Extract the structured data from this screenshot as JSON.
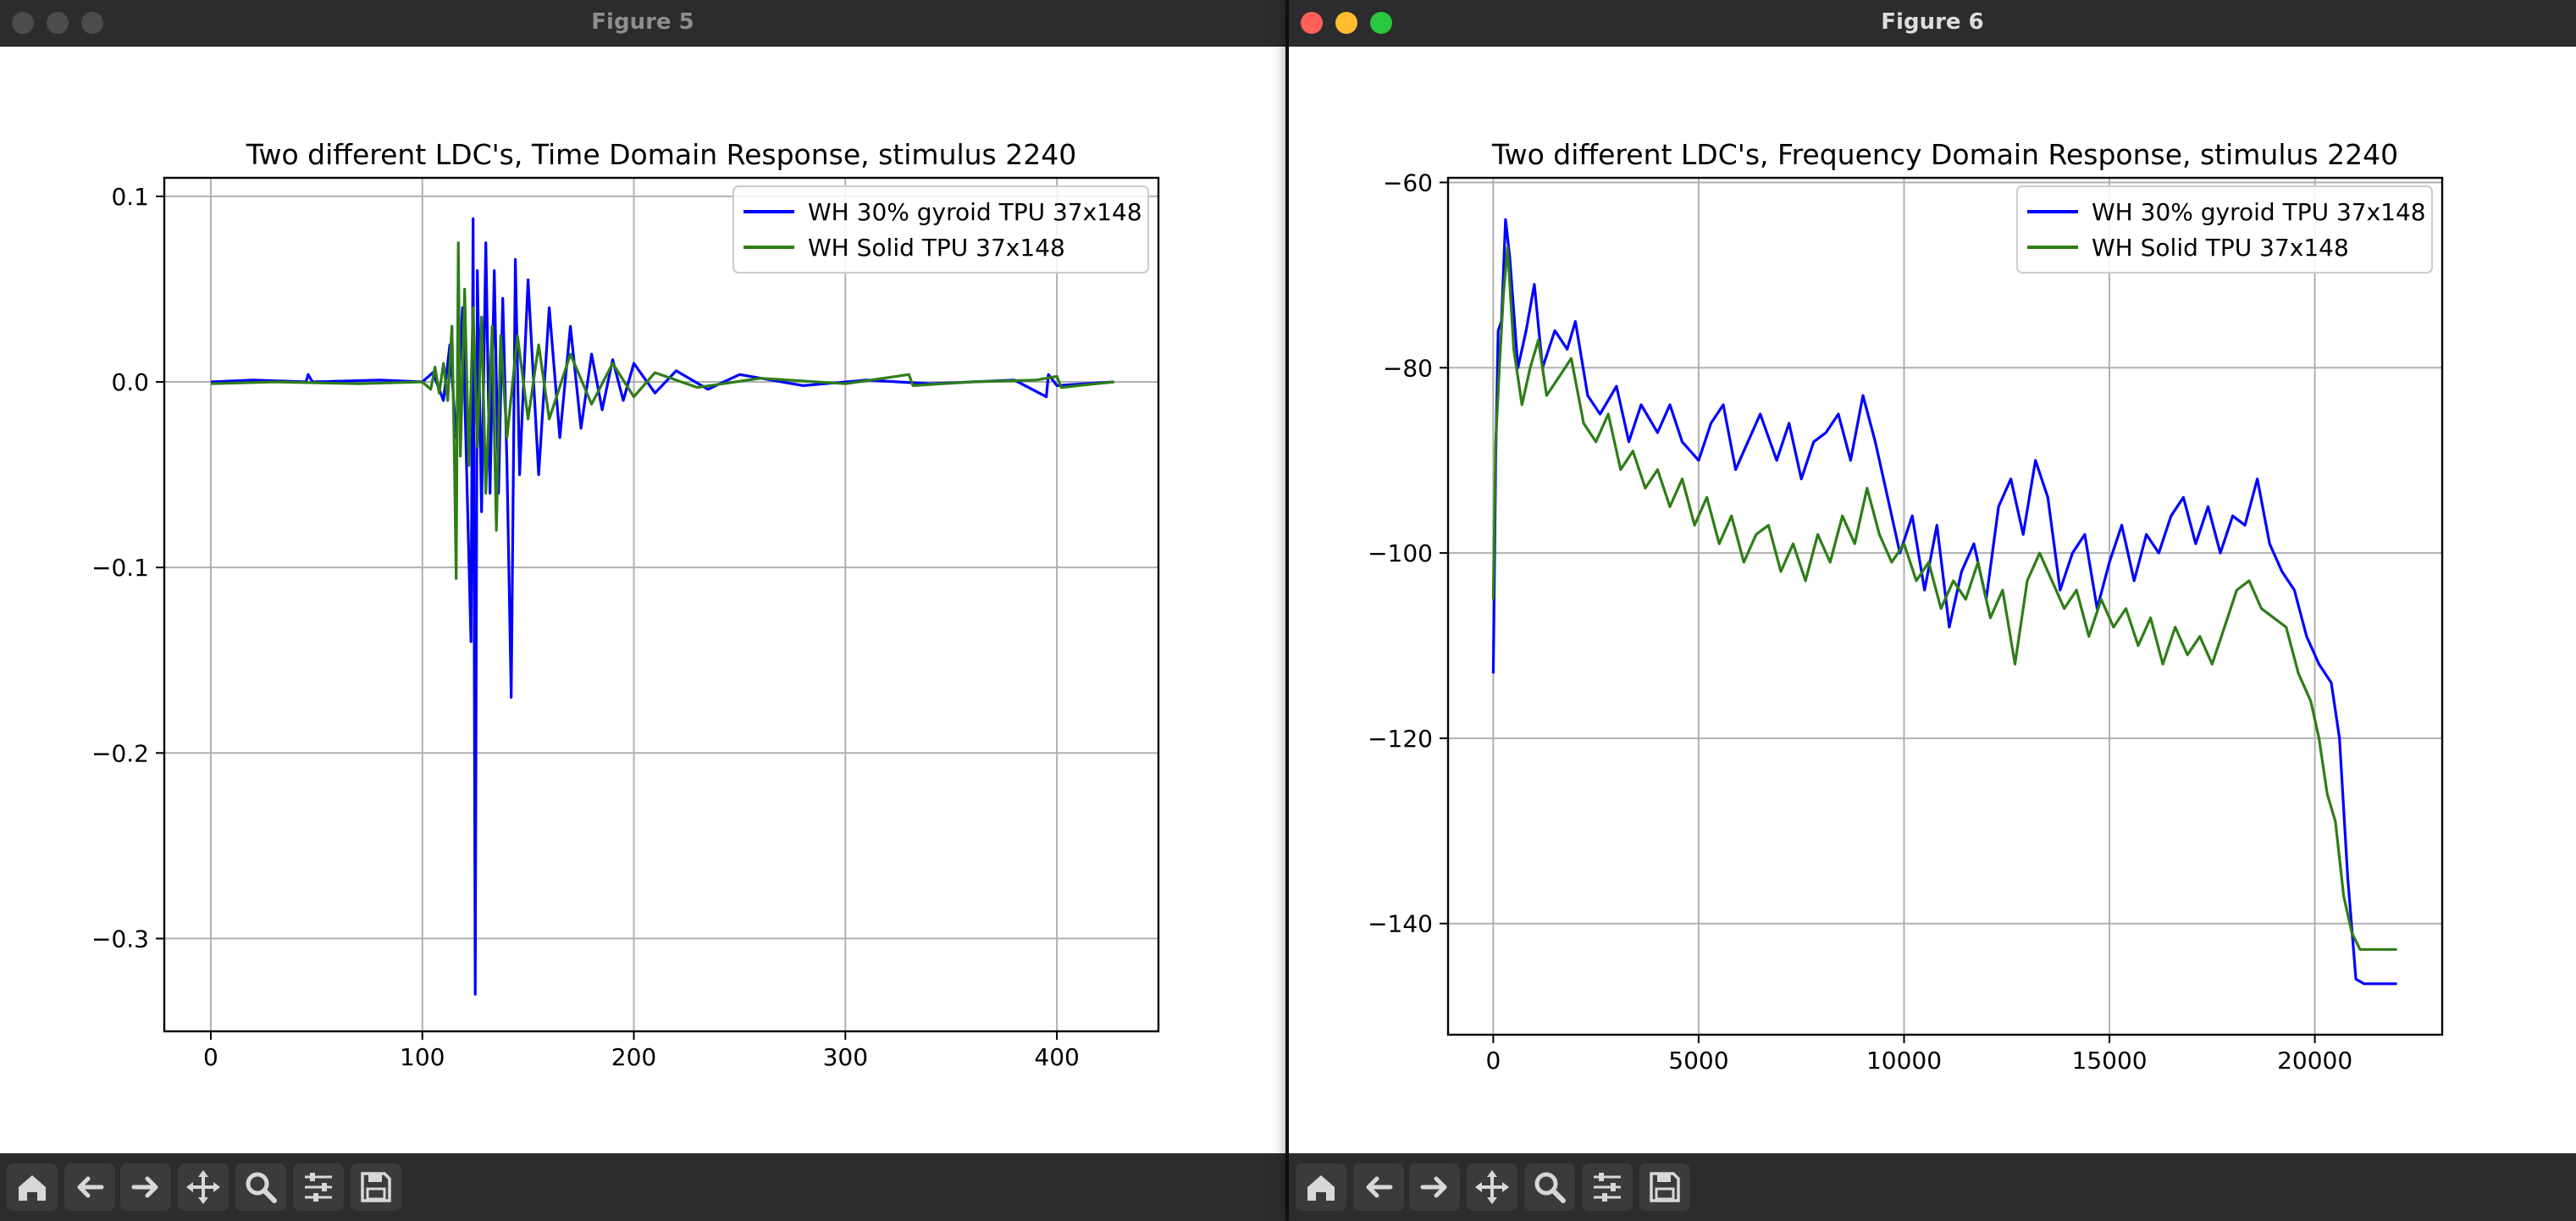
{
  "windows": [
    {
      "title": "Figure 5"
    },
    {
      "title": "Figure 6"
    }
  ],
  "toolbar": {
    "buttons": [
      {
        "icon": "home-icon"
      },
      {
        "icon": "back-arrow-icon"
      },
      {
        "icon": "forward-arrow-icon"
      },
      {
        "icon": "pan-icon"
      },
      {
        "icon": "zoom-icon"
      },
      {
        "icon": "sliders-icon"
      },
      {
        "icon": "save-icon"
      }
    ]
  },
  "chart_data": [
    {
      "type": "line",
      "title": "Two different LDC's, Time Domain Response, stimulus 2240",
      "xlabel": "",
      "ylabel": "",
      "xlim": [
        -22,
        448
      ],
      "ylim": [
        -0.35,
        0.11
      ],
      "xticks": [
        0,
        100,
        200,
        300,
        400
      ],
      "xtick_labels": [
        "0",
        "100",
        "200",
        "300",
        "400"
      ],
      "yticks": [
        0.1,
        0.0,
        -0.1,
        -0.2,
        -0.3
      ],
      "ytick_labels": [
        "0.1",
        "0.0",
        "−0.1",
        "−0.2",
        "−0.3"
      ],
      "grid": true,
      "legend_position": "upper right",
      "series": [
        {
          "name": "WH 30% gyroid TPU 37x148",
          "color": "#0000ff",
          "points": [
            [
              0,
              0.0
            ],
            [
              20,
              0.001
            ],
            [
              45,
              0.0
            ],
            [
              46,
              0.004
            ],
            [
              48,
              0.0
            ],
            [
              80,
              0.001
            ],
            [
              100,
              0.0
            ],
            [
              105,
              0.005
            ],
            [
              110,
              -0.01
            ],
            [
              113,
              0.02
            ],
            [
              116,
              -0.03
            ],
            [
              119,
              0.04
            ],
            [
              121,
              -0.05
            ],
            [
              123,
              -0.14
            ],
            [
              124,
              0.088
            ],
            [
              125,
              -0.33
            ],
            [
              126,
              0.06
            ],
            [
              128,
              -0.07
            ],
            [
              130,
              0.075
            ],
            [
              132,
              -0.06
            ],
            [
              134,
              0.06
            ],
            [
              136,
              -0.06
            ],
            [
              138,
              0.045
            ],
            [
              140,
              -0.045
            ],
            [
              142,
              -0.17
            ],
            [
              144,
              0.066
            ],
            [
              146,
              -0.05
            ],
            [
              150,
              0.055
            ],
            [
              155,
              -0.05
            ],
            [
              160,
              0.04
            ],
            [
              165,
              -0.03
            ],
            [
              170,
              0.03
            ],
            [
              175,
              -0.025
            ],
            [
              180,
              0.015
            ],
            [
              185,
              -0.015
            ],
            [
              190,
              0.012
            ],
            [
              195,
              -0.01
            ],
            [
              200,
              0.01
            ],
            [
              210,
              -0.006
            ],
            [
              220,
              0.006
            ],
            [
              235,
              -0.004
            ],
            [
              250,
              0.004
            ],
            [
              280,
              -0.002
            ],
            [
              310,
              0.001
            ],
            [
              340,
              -0.001
            ],
            [
              380,
              0.001
            ],
            [
              395,
              -0.008
            ],
            [
              396,
              0.004
            ],
            [
              400,
              -0.002
            ],
            [
              427,
              0.0
            ]
          ]
        },
        {
          "name": "WH Solid TPU 37x148",
          "color": "#2e7d17",
          "points": [
            [
              0,
              -0.001
            ],
            [
              30,
              0.0
            ],
            [
              70,
              -0.001
            ],
            [
              100,
              0.0
            ],
            [
              104,
              -0.004
            ],
            [
              106,
              0.008
            ],
            [
              108,
              -0.006
            ],
            [
              110,
              0.01
            ],
            [
              112,
              -0.01
            ],
            [
              114,
              0.03
            ],
            [
              115,
              -0.03
            ],
            [
              116,
              -0.106
            ],
            [
              117,
              0.075
            ],
            [
              118,
              -0.04
            ],
            [
              120,
              0.05
            ],
            [
              122,
              -0.045
            ],
            [
              124,
              0.04
            ],
            [
              126,
              -0.035
            ],
            [
              128,
              0.035
            ],
            [
              130,
              -0.06
            ],
            [
              133,
              0.03
            ],
            [
              135,
              -0.08
            ],
            [
              137,
              0.025
            ],
            [
              140,
              -0.03
            ],
            [
              145,
              0.025
            ],
            [
              150,
              -0.02
            ],
            [
              155,
              0.02
            ],
            [
              160,
              -0.02
            ],
            [
              170,
              0.015
            ],
            [
              180,
              -0.012
            ],
            [
              190,
              0.01
            ],
            [
              200,
              -0.008
            ],
            [
              210,
              0.005
            ],
            [
              230,
              -0.003
            ],
            [
              260,
              0.002
            ],
            [
              300,
              -0.001
            ],
            [
              330,
              0.004
            ],
            [
              332,
              -0.002
            ],
            [
              360,
              0.0
            ],
            [
              390,
              0.001
            ],
            [
              400,
              0.003
            ],
            [
              402,
              -0.003
            ],
            [
              427,
              0.0
            ]
          ]
        }
      ]
    },
    {
      "type": "line",
      "title": "Two different LDC's, Frequency Domain Response, stimulus 2240",
      "xlabel": "",
      "ylabel": "",
      "xlim": [
        -1100,
        23100
      ],
      "ylim": [
        -152,
        -59.5
      ],
      "xticks": [
        0,
        5000,
        10000,
        15000,
        20000
      ],
      "xtick_labels": [
        "0",
        "5000",
        "10000",
        "15000",
        "20000"
      ],
      "yticks": [
        -60,
        -80,
        -100,
        -120,
        -140
      ],
      "ytick_labels": [
        "−60",
        "−80",
        "−100",
        "−120",
        "−140"
      ],
      "grid": true,
      "legend_position": "upper right",
      "series": [
        {
          "name": "WH 30% gyroid TPU 37x148",
          "color": "#0000ff",
          "points": [
            [
              0,
              -113
            ],
            [
              60,
              -90
            ],
            [
              120,
              -76
            ],
            [
              200,
              -75
            ],
            [
              300,
              -64
            ],
            [
              400,
              -68
            ],
            [
              600,
              -80
            ],
            [
              800,
              -76
            ],
            [
              1000,
              -71
            ],
            [
              1200,
              -80
            ],
            [
              1500,
              -76
            ],
            [
              1800,
              -78
            ],
            [
              2000,
              -75
            ],
            [
              2300,
              -83
            ],
            [
              2600,
              -85
            ],
            [
              3000,
              -82
            ],
            [
              3300,
              -88
            ],
            [
              3600,
              -84
            ],
            [
              4000,
              -87
            ],
            [
              4300,
              -84
            ],
            [
              4600,
              -88
            ],
            [
              5000,
              -90
            ],
            [
              5300,
              -86
            ],
            [
              5600,
              -84
            ],
            [
              5900,
              -91
            ],
            [
              6200,
              -88
            ],
            [
              6500,
              -85
            ],
            [
              6900,
              -90
            ],
            [
              7200,
              -86
            ],
            [
              7500,
              -92
            ],
            [
              7800,
              -88
            ],
            [
              8100,
              -87
            ],
            [
              8400,
              -85
            ],
            [
              8700,
              -90
            ],
            [
              9000,
              -83
            ],
            [
              9300,
              -88
            ],
            [
              9600,
              -94
            ],
            [
              9900,
              -100
            ],
            [
              10200,
              -96
            ],
            [
              10500,
              -104
            ],
            [
              10800,
              -97
            ],
            [
              11100,
              -108
            ],
            [
              11400,
              -102
            ],
            [
              11700,
              -99
            ],
            [
              12000,
              -105
            ],
            [
              12300,
              -95
            ],
            [
              12600,
              -92
            ],
            [
              12900,
              -98
            ],
            [
              13200,
              -90
            ],
            [
              13500,
              -94
            ],
            [
              13800,
              -104
            ],
            [
              14100,
              -100
            ],
            [
              14400,
              -98
            ],
            [
              14700,
              -106
            ],
            [
              15000,
              -101
            ],
            [
              15300,
              -97
            ],
            [
              15600,
              -103
            ],
            [
              15900,
              -98
            ],
            [
              16200,
              -100
            ],
            [
              16500,
              -96
            ],
            [
              16800,
              -94
            ],
            [
              17100,
              -99
            ],
            [
              17400,
              -95
            ],
            [
              17700,
              -100
            ],
            [
              18000,
              -96
            ],
            [
              18300,
              -97
            ],
            [
              18600,
              -92
            ],
            [
              18900,
              -99
            ],
            [
              19200,
              -102
            ],
            [
              19500,
              -104
            ],
            [
              19800,
              -109
            ],
            [
              20100,
              -112
            ],
            [
              20400,
              -114
            ],
            [
              20600,
              -120
            ],
            [
              20800,
              -135
            ],
            [
              21000,
              -146
            ],
            [
              21200,
              -146.5
            ],
            [
              22000,
              -146.5
            ]
          ]
        },
        {
          "name": "WH Solid TPU 37x148",
          "color": "#2e7d17",
          "points": [
            [
              0,
              -105
            ],
            [
              60,
              -88
            ],
            [
              150,
              -80
            ],
            [
              250,
              -72
            ],
            [
              350,
              -67
            ],
            [
              500,
              -78
            ],
            [
              700,
              -84
            ],
            [
              900,
              -80
            ],
            [
              1100,
              -77
            ],
            [
              1300,
              -83
            ],
            [
              1600,
              -81
            ],
            [
              1900,
              -79
            ],
            [
              2200,
              -86
            ],
            [
              2500,
              -88
            ],
            [
              2800,
              -85
            ],
            [
              3100,
              -91
            ],
            [
              3400,
              -89
            ],
            [
              3700,
              -93
            ],
            [
              4000,
              -91
            ],
            [
              4300,
              -95
            ],
            [
              4600,
              -92
            ],
            [
              4900,
              -97
            ],
            [
              5200,
              -94
            ],
            [
              5500,
              -99
            ],
            [
              5800,
              -96
            ],
            [
              6100,
              -101
            ],
            [
              6400,
              -98
            ],
            [
              6700,
              -97
            ],
            [
              7000,
              -102
            ],
            [
              7300,
              -99
            ],
            [
              7600,
              -103
            ],
            [
              7900,
              -98
            ],
            [
              8200,
              -101
            ],
            [
              8500,
              -96
            ],
            [
              8800,
              -99
            ],
            [
              9100,
              -93
            ],
            [
              9400,
              -98
            ],
            [
              9700,
              -101
            ],
            [
              10000,
              -99
            ],
            [
              10300,
              -103
            ],
            [
              10600,
              -101
            ],
            [
              10900,
              -106
            ],
            [
              11200,
              -103
            ],
            [
              11500,
              -105
            ],
            [
              11800,
              -101
            ],
            [
              12100,
              -107
            ],
            [
              12400,
              -104
            ],
            [
              12700,
              -112
            ],
            [
              13000,
              -103
            ],
            [
              13300,
              -100
            ],
            [
              13600,
              -103
            ],
            [
              13900,
              -106
            ],
            [
              14200,
              -104
            ],
            [
              14500,
              -109
            ],
            [
              14800,
              -105
            ],
            [
              15100,
              -108
            ],
            [
              15400,
              -106
            ],
            [
              15700,
              -110
            ],
            [
              16000,
              -107
            ],
            [
              16300,
              -112
            ],
            [
              16600,
              -108
            ],
            [
              16900,
              -111
            ],
            [
              17200,
              -109
            ],
            [
              17500,
              -112
            ],
            [
              17800,
              -108
            ],
            [
              18100,
              -104
            ],
            [
              18400,
              -103
            ],
            [
              18700,
              -106
            ],
            [
              19000,
              -107
            ],
            [
              19300,
              -108
            ],
            [
              19600,
              -113
            ],
            [
              19900,
              -116
            ],
            [
              20100,
              -120
            ],
            [
              20300,
              -126
            ],
            [
              20500,
              -129
            ],
            [
              20700,
              -137
            ],
            [
              20900,
              -141
            ],
            [
              21100,
              -142.8
            ],
            [
              22000,
              -142.8
            ]
          ]
        }
      ]
    }
  ]
}
